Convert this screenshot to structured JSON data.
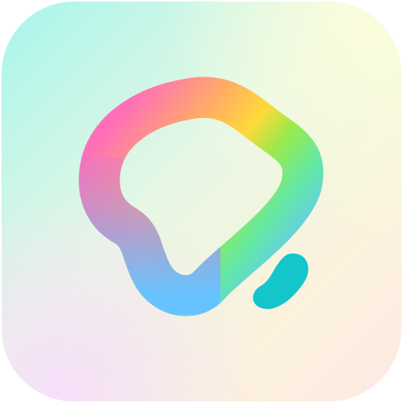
{
  "icon": {
    "name": "bell-app-icon",
    "colors": {
      "background_top_left": "#A8F5EC",
      "background_top_right": "#FBFDDC",
      "background_bottom_left": "#F6E2F8",
      "background_bottom_right": "#FCEEE3",
      "bell_pink": "#FF6FB8",
      "bell_orange": "#FFB061",
      "bell_yellow": "#FFD93A",
      "bell_green": "#9BEA4A",
      "bell_mint": "#63E8A6",
      "bell_blue": "#67C3FF",
      "bell_violet": "#9F9DE8",
      "clapper_teal": "#14C5CA"
    }
  }
}
